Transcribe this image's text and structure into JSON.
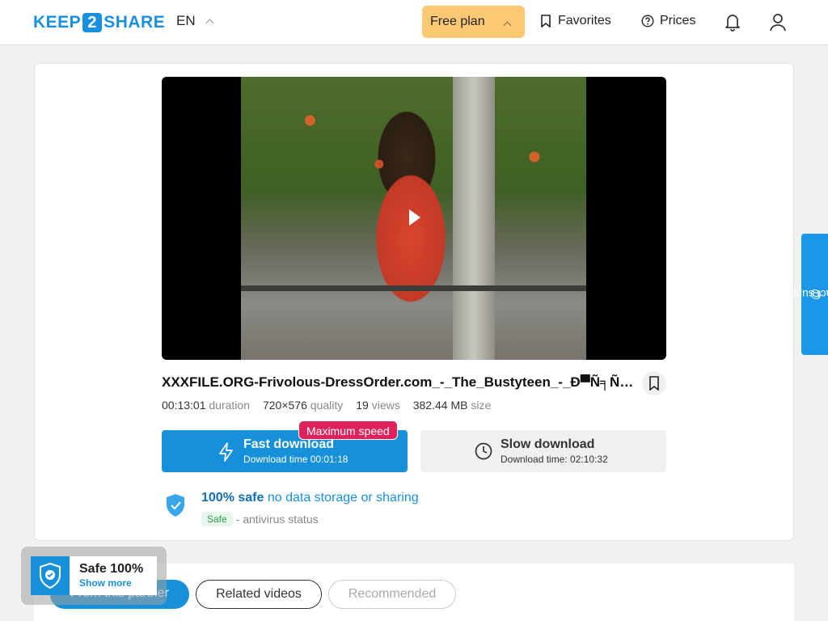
{
  "header": {
    "logo_left": "KEEP",
    "logo_num": "2",
    "logo_right": "SHARE",
    "language": "EN",
    "plan": "Free plan",
    "favorites": "Favorites",
    "prices": "Prices"
  },
  "video": {
    "title": "XXXFILE.ORG-Frivolous-DressOrder.com_-_The_Bustyteen_-_Ð▀Ñ╕Ñ╕Ð´Ð°...",
    "duration": "00:13:01",
    "duration_label": "duration",
    "quality": "720×576",
    "quality_label": "quality",
    "views": "19",
    "views_label": "views",
    "size": "382.44 MB",
    "size_label": "size"
  },
  "download": {
    "fast_label": "Fast download",
    "fast_time": "Download time 00:01:18",
    "badge": "Maximum speed",
    "slow_label": "Slow download",
    "slow_time": "Download time: 02:10:32"
  },
  "safety": {
    "headline_bold": "100% safe",
    "headline_rest": "no data storage or sharing",
    "status_pill": "Safe",
    "status_text": "- antivirus status"
  },
  "tabs": [
    "From this partner",
    "Related videos",
    "Recommended"
  ],
  "safe_widget": {
    "title": "Safe 100%",
    "link": "Show more"
  },
  "support": "contact support",
  "colors": {
    "accent": "#1690d9",
    "plan": "#fdc874",
    "badge": "#e0225a"
  }
}
